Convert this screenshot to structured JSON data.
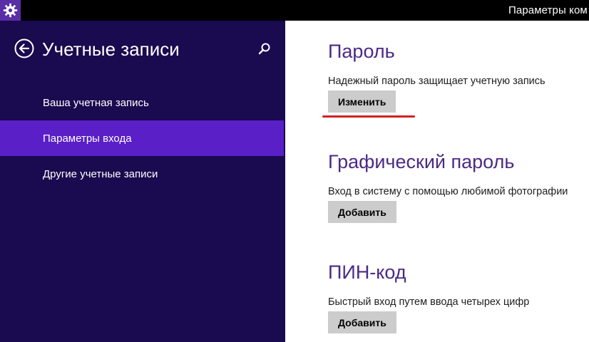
{
  "titlebar": {
    "app_title": "Параметры ком",
    "settings_icon": "gear-icon"
  },
  "left_pane": {
    "title": "Учетные записи",
    "back_icon": "back-arrow-icon",
    "search_icon": "search-icon",
    "items": [
      {
        "label": "Ваша учетная запись",
        "active": false
      },
      {
        "label": "Параметры входа",
        "active": true
      },
      {
        "label": "Другие учетные записи",
        "active": false
      }
    ]
  },
  "main": {
    "sections": [
      {
        "title": "Пароль",
        "description": "Надежный пароль защищает учетную запись",
        "button_label": "Изменить"
      },
      {
        "title": "Графический пароль",
        "description": "Вход в систему с помощью любимой фотографии",
        "button_label": "Добавить"
      },
      {
        "title": "ПИН-код",
        "description": "Быстрый вход путем ввода четырех цифр",
        "button_label": "Добавить"
      }
    ]
  },
  "colors": {
    "left_pane_bg": "#1a0a4f",
    "active_item_bg": "#5a1fc7",
    "section_title": "#4b2a86",
    "annotation_underline": "#d22020"
  }
}
